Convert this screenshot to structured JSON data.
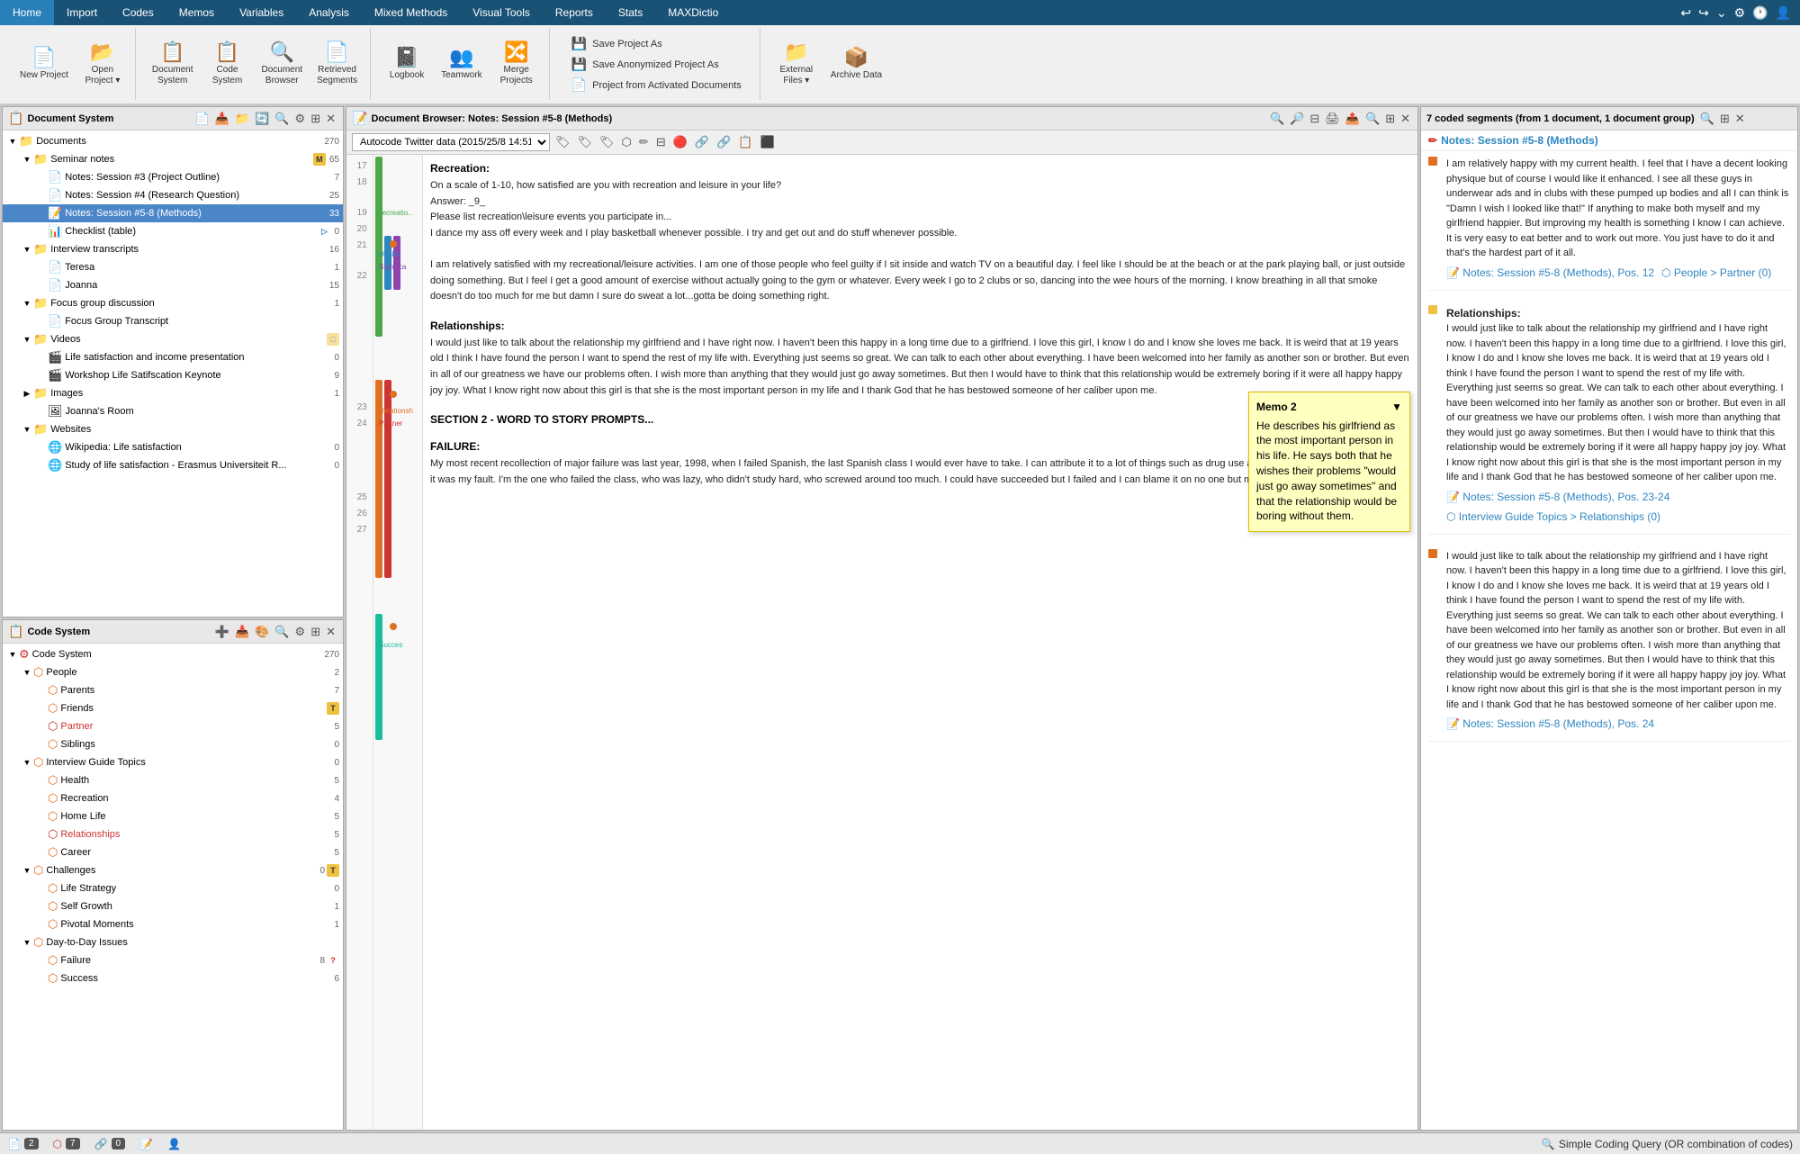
{
  "menu": {
    "items": [
      "Home",
      "Import",
      "Codes",
      "Memos",
      "Variables",
      "Analysis",
      "Mixed Methods",
      "Visual Tools",
      "Reports",
      "Stats",
      "MAXDictio"
    ],
    "active": "Home"
  },
  "toolbar": {
    "new_project": "New\nProject",
    "open_project": "Open\nProject",
    "document_system": "Document\nSystem",
    "code_system": "Code\nSystem",
    "document_browser": "Document\nBrowser",
    "retrieved_segments": "Retrieved\nSegments",
    "logbook": "Logbook",
    "teamwork": "Teamwork",
    "merge_projects": "Merge\nProjects",
    "external_files": "External\nFiles",
    "archive_data": "Archive\nData",
    "save_project_as": "Save Project As",
    "save_anonymized": "Save Anonymized Project As",
    "project_from_activated": "Project from Activated Documents"
  },
  "doc_system": {
    "title": "Document System",
    "total": "270",
    "tree": [
      {
        "label": "Documents",
        "count": "270",
        "indent": 0,
        "type": "folder",
        "expanded": true
      },
      {
        "label": "Seminar notes",
        "count": "65",
        "indent": 1,
        "type": "folder",
        "expanded": true
      },
      {
        "label": "Notes: Session #3 (Project Outline)",
        "count": "7",
        "indent": 2,
        "type": "doc"
      },
      {
        "label": "Notes: Session #4 (Research Question)",
        "count": "25",
        "indent": 2,
        "type": "doc"
      },
      {
        "label": "Notes: Session #5-8 (Methods)",
        "count": "33",
        "indent": 2,
        "type": "doc",
        "active": true
      },
      {
        "label": "Checklist (table)",
        "count": "0",
        "indent": 2,
        "type": "table"
      },
      {
        "label": "Interview transcripts",
        "count": "16",
        "indent": 1,
        "type": "folder",
        "expanded": true
      },
      {
        "label": "Teresa",
        "count": "1",
        "indent": 2,
        "type": "doc"
      },
      {
        "label": "Joanna",
        "count": "15",
        "indent": 2,
        "type": "doc"
      },
      {
        "label": "Focus group discussion",
        "count": "1",
        "indent": 1,
        "type": "folder",
        "expanded": true
      },
      {
        "label": "Focus Group Transcript",
        "count": "",
        "indent": 2,
        "type": "doc"
      },
      {
        "label": "Videos",
        "count": "",
        "indent": 1,
        "type": "folder",
        "expanded": true
      },
      {
        "label": "Life satisfaction and income presentation",
        "count": "0",
        "indent": 2,
        "type": "video"
      },
      {
        "label": "Workshop Life Satisfaction Keynote",
        "count": "9",
        "indent": 2,
        "type": "video"
      },
      {
        "label": "Images",
        "count": "1",
        "indent": 1,
        "type": "folder"
      },
      {
        "label": "Joanna's Room",
        "count": "",
        "indent": 2,
        "type": "image"
      },
      {
        "label": "Websites",
        "count": "",
        "indent": 1,
        "type": "folder",
        "expanded": true
      },
      {
        "label": "Wikipedia: Life satisfaction",
        "count": "0",
        "indent": 2,
        "type": "web"
      },
      {
        "label": "Study of life satisfaction - Erasmus Universiteit R...",
        "count": "0",
        "indent": 2,
        "type": "web"
      }
    ]
  },
  "code_system": {
    "title": "Code System",
    "total": "270",
    "tree": [
      {
        "label": "Code System",
        "count": "270",
        "indent": 0,
        "type": "codesys",
        "expanded": true
      },
      {
        "label": "People",
        "count": "2",
        "indent": 1,
        "type": "code",
        "expanded": true,
        "color": "orange"
      },
      {
        "label": "Parents",
        "count": "7",
        "indent": 2,
        "type": "code",
        "color": "orange"
      },
      {
        "label": "Friends",
        "count": "",
        "indent": 2,
        "type": "code",
        "color": "orange"
      },
      {
        "label": "Partner",
        "count": "5",
        "indent": 2,
        "type": "code",
        "color": "red"
      },
      {
        "label": "Siblings",
        "count": "0",
        "indent": 2,
        "type": "code",
        "color": "orange"
      },
      {
        "label": "Interview Guide Topics",
        "count": "0",
        "indent": 1,
        "type": "code",
        "expanded": true,
        "color": "orange"
      },
      {
        "label": "Health",
        "count": "5",
        "indent": 2,
        "type": "code",
        "color": "orange"
      },
      {
        "label": "Recreation",
        "count": "4",
        "indent": 2,
        "type": "code",
        "color": "orange"
      },
      {
        "label": "Home Life",
        "count": "5",
        "indent": 2,
        "type": "code",
        "color": "orange"
      },
      {
        "label": "Relationships",
        "count": "5",
        "indent": 2,
        "type": "code",
        "color": "red"
      },
      {
        "label": "Career",
        "count": "5",
        "indent": 2,
        "type": "code",
        "color": "orange"
      },
      {
        "label": "Challenges",
        "count": "0",
        "indent": 1,
        "type": "code",
        "expanded": true,
        "color": "orange"
      },
      {
        "label": "Life Strategy",
        "count": "0",
        "indent": 2,
        "type": "code",
        "color": "orange"
      },
      {
        "label": "Self Growth",
        "count": "1",
        "indent": 2,
        "type": "code",
        "color": "orange"
      },
      {
        "label": "Pivotal Moments",
        "count": "1",
        "indent": 2,
        "type": "code",
        "color": "orange"
      },
      {
        "label": "Day-to-Day Issues",
        "count": "",
        "indent": 1,
        "type": "code",
        "expanded": true,
        "color": "orange"
      },
      {
        "label": "Failure",
        "count": "8",
        "indent": 2,
        "type": "code",
        "color": "orange"
      },
      {
        "label": "Success",
        "count": "6",
        "indent": 2,
        "type": "code",
        "color": "orange"
      }
    ]
  },
  "document_browser": {
    "title": "Document Browser: Notes: Session #5-8 (Methods)",
    "autocode": "Autocode Twitter data (2015/25/8 14:51)",
    "sections": [
      {
        "line_start": 17,
        "title": "Recreation:",
        "content": "On a scale of 1-10, how satisfied are you with recreation and leisure in your life?\nAnswer: _9_\nPlease list recreation\\leisure events you participate in...\nI dance my ass off every week and I play basketball whenever possible. I try and get out and do stuff whenever possible.\n\nI am relatively satisfied with my recreational/leisure activities. I am one of those people who feel guilty if I sit inside and watch TV on a beautiful day. I feel like I should be at the beach or at the park playing ball, or just outside doing something. But I feel I get a good amount of exercise without actually going to the gym or whatever. Every week I go to 2 clubs or so, dancing into the wee hours of the morning. I know breathing in all that smoke doesn't do too much for me but damn I sure do sweat a lot...gotta be doing something right.",
        "codes": [
          "Recreatio..",
          "..Health",
          "..Significa"
        ]
      },
      {
        "line_start": 23,
        "title": "Relationships:",
        "content": "I would just like to talk about the relationship my girlfriend and I have right now. I haven't been this happy in a long time due to a girlfriend. I love this girl, I know I do and I know she loves me back. It is weird that at 19 years old I think I have found the person I want to spend the rest of my life with. Everything just seems so great. We can talk to each other about everything. I have been welcomed into her family as another son or brother. But even in all of our greatness we have our problems often. I wish more than anything that they would just go away sometimes. But then I would have to think that this relationship would be extremely boring if it were all happy happy joy joy. What I know right now about this girl is that she is the most important person in my life and I thank God that he has bestowed someone of her caliber upon me.",
        "codes": [
          "..Relationsh",
          "..Partner"
        ]
      },
      {
        "line_start": 25,
        "title": "SECTION 2 - WORD TO STORY PROMPTS...",
        "content": ""
      },
      {
        "line_start": 26,
        "title": "FAILURE:",
        "content": "My most recent recollection of major failure was last year, 1998, when I failed Spanish, the last Spanish class I would ever have to take. I can attribute it to a lot of things such as drug use and what not, but more than anything it was my fault. I'm the one who failed the class, who was lazy, who didn't study hard, who screwed around too much. I could have succeeded but I failed and I can blame it on no one but myself.",
        "codes": [
          "..Succes"
        ]
      }
    ],
    "memo": {
      "title": "Memo 2",
      "content": "He describes his girlfriend as the most important person in his life. He says both that he wishes their problems \"would just go away sometimes\" and that the relationship would be boring without them."
    }
  },
  "right_panel": {
    "header": "7 coded segments (from 1 document, 1 document group)",
    "doc_title": "Notes: Session #5-8 (Methods)",
    "segments": [
      {
        "indicator": "orange",
        "text": "I am relatively happy with my current health. I feel that I have a decent looking physique but of course I would like it enhanced. I see all these guys in underwear ads and in clubs with these pumped up bodies and all I can think is \"Damn I wish I looked like that!\" If anything to make both myself and my girlfriend happier. But improving my health is something I know I can achieve. It is very easy to eat better and to work out more. You just have to do it and that's the hardest part of it all.",
        "ref": "Notes: Session #5-8 (Methods), Pos. 12",
        "code": "People > Partner (0)"
      },
      {
        "indicator": "yellow",
        "text": "Relationships:\nI would just like to talk about the relationship my girlfriend and I have right now. I haven't been this happy in a long time due to a girlfriend. I love this girl, I know I do and I know she loves me back. It is weird that at 19 years old I think I have found the person I want to spend the rest of my life with. Everything just seems so great. We can talk to each other about everything. I have been welcomed into her family as another son or brother. But even in all of our greatness we have our problems often. I wish more than anything that they would just go away sometimes. But then I would have to think that this relationship would be extremely boring if it were all happy happy joy joy. What I know right now about this girl is that she is the most important person in my life and I thank God that he has bestowed someone of her caliber upon me.",
        "ref": "Notes: Session #5-8 (Methods), Pos. 23-24",
        "code": "Interview Guide Topics > Relationships (0)"
      },
      {
        "indicator": "orange",
        "text": "I would just like to talk about the relationship my girlfriend and I have right now. I haven't been this happy in a long time due to a girlfriend. I love this girl, I know I do and I know she loves me back. It is weird that at 19 years old I think I have found the person I want to spend the rest of my life with. Everything just seems so great. We can talk to each other about everything. I have been welcomed into her family as another son or brother. But even in all of our greatness we have our problems often. I wish more than anything that they would just go away sometimes. But then I would have to think that this relationship would be extremely boring if it were all happy happy joy joy. What I know right now about this girl is that she is the most important person in my life and I thank God that he has bestowed someone of her caliber upon me.",
        "ref": "Notes: Session #5-8 (Methods), Pos. 24",
        "code": ""
      }
    ]
  },
  "status_bar": {
    "items": [
      {
        "icon": "doc",
        "count": "2"
      },
      {
        "icon": "code",
        "count": "7"
      },
      {
        "icon": "link",
        "count": "0"
      },
      {
        "icon": "memo",
        "count": ""
      },
      {
        "icon": "person",
        "count": ""
      }
    ],
    "query": "Simple Coding Query (OR combination of codes)"
  }
}
